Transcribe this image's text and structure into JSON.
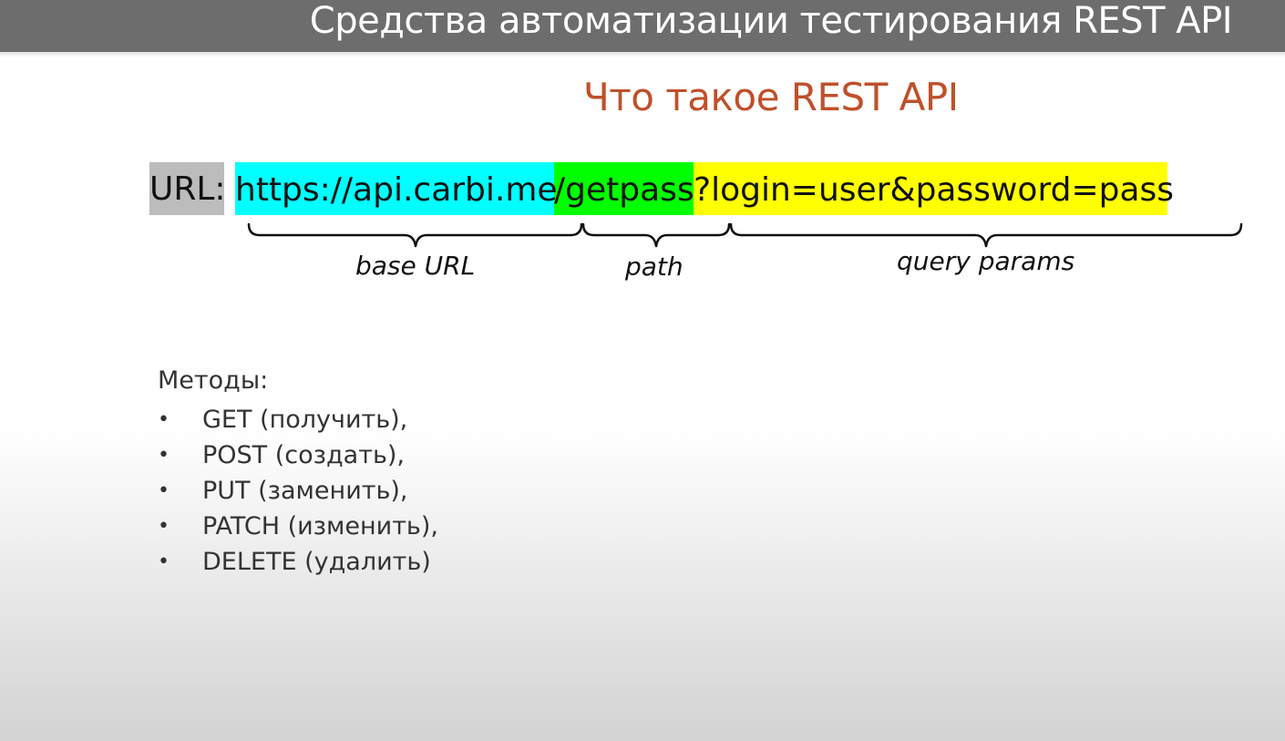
{
  "header": {
    "title": "Средства автоматизации тестирования REST API"
  },
  "slide": {
    "title": "Что такое REST API"
  },
  "url_example": {
    "label": "URL:",
    "base_url": "https://api.carbi.me",
    "path": "/getpass",
    "query": "?login=user&password=pass",
    "colors": {
      "base_url": "#00ffff",
      "path": "#00ff00",
      "query": "#ffff00",
      "label": "#bcbcbc"
    }
  },
  "annotations": {
    "base_url": "base URL",
    "path": "path",
    "query": "query params"
  },
  "methods": {
    "heading": "Методы:",
    "items": [
      "GET (получить),",
      "POST (создать),",
      "PUT (заменить),",
      "PATCH (изменить),",
      "DELETE (удалить)"
    ],
    "bullet": "•"
  },
  "colors": {
    "header_bg": "#6d6d6d",
    "title_accent": "#c0502a"
  }
}
